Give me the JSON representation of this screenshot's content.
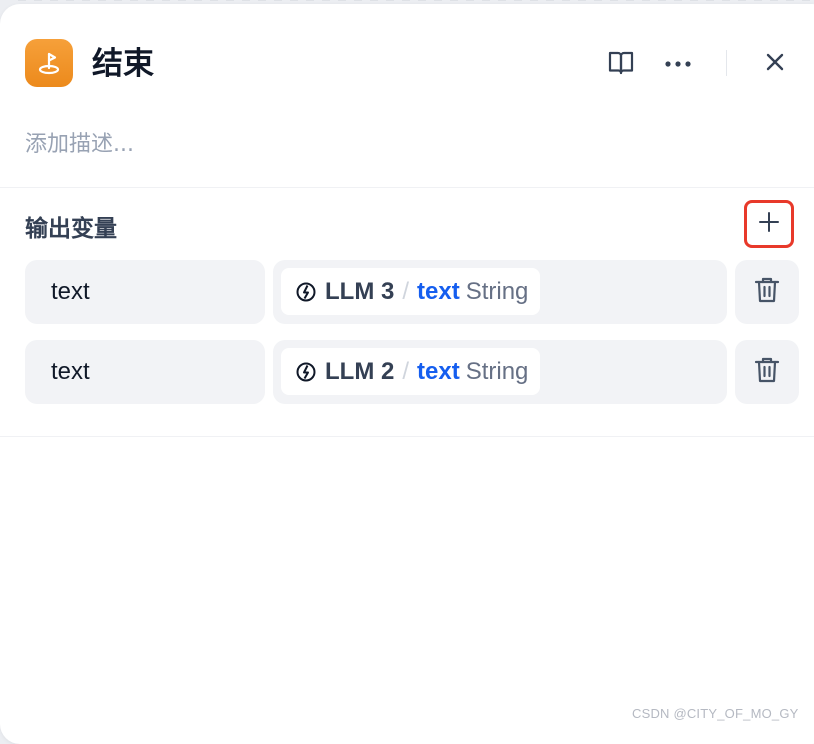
{
  "header": {
    "title": "结束",
    "icons": {
      "node": "end-node-icon",
      "docs": "book-icon",
      "more": "more-icon",
      "close": "close-icon"
    }
  },
  "description": {
    "placeholder": "添加描述..."
  },
  "outputs": {
    "title": "输出变量",
    "add_icon": "plus-icon",
    "items": [
      {
        "name": "text",
        "node": "LLM 3",
        "variable": "text",
        "type": "String"
      },
      {
        "name": "text",
        "node": "LLM 2",
        "variable": "text",
        "type": "String"
      }
    ]
  },
  "watermark": "CSDN @CITY_OF_MO_GY",
  "colors": {
    "node_icon": "#F08C1E",
    "accent": "#155EEF",
    "highlight_border": "#E8392A"
  }
}
